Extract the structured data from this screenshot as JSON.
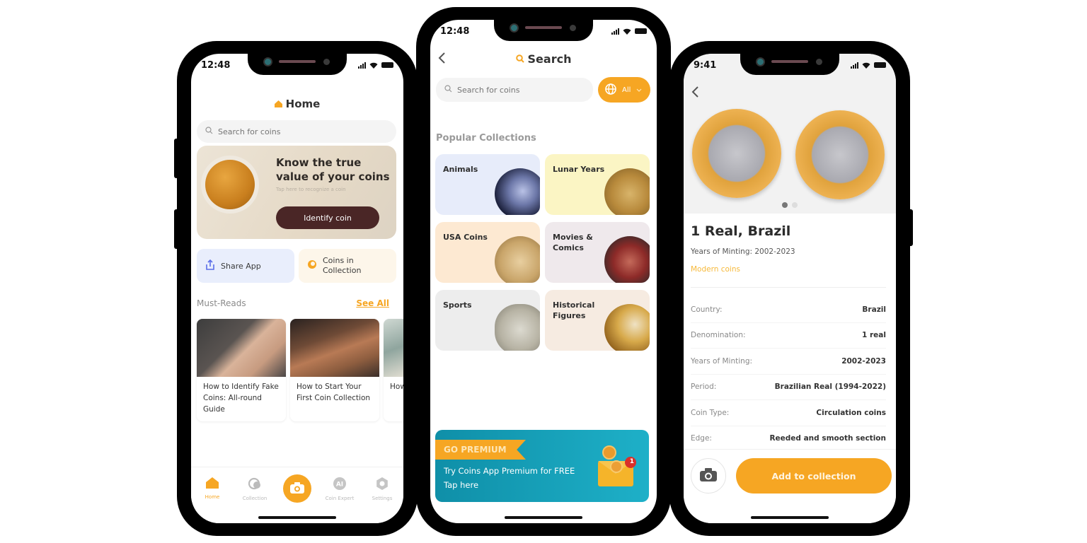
{
  "phones": {
    "home": {
      "status": {
        "time": "12:48"
      },
      "title": "Home",
      "search": {
        "placeholder": "Search for coins"
      },
      "hero": {
        "heading": "Know the true value of your coins",
        "subtitle": "Tap here to recognize a coin",
        "button": "Identify coin"
      },
      "quick_actions": [
        {
          "label": "Share App",
          "icon": "share-icon"
        },
        {
          "label": "Coins in Collection",
          "icon": "coins-icon"
        }
      ],
      "must_reads": {
        "title": "Must-Reads",
        "see_all": "See All",
        "articles": [
          {
            "title": "How to Identify Fake Coins: All-round Guide"
          },
          {
            "title": "How to Start Your First Coin Collection"
          },
          {
            "title": "How to w... a c..."
          }
        ]
      },
      "tabbar": [
        {
          "label": "Home",
          "icon": "home-icon",
          "active": true
        },
        {
          "label": "Collection",
          "icon": "collection-icon",
          "active": false
        },
        {
          "label": "",
          "icon": "camera-icon",
          "active": false
        },
        {
          "label": "Coin Expert",
          "icon": "ai-icon",
          "active": false
        },
        {
          "label": "Settings",
          "icon": "gear-icon",
          "active": false
        }
      ]
    },
    "search": {
      "status": {
        "time": "12:48"
      },
      "title": "Search",
      "search": {
        "placeholder": "Search for coins"
      },
      "filter": {
        "value": "All"
      },
      "popular_title": "Popular Collections",
      "collections": [
        {
          "label": "Animals",
          "bg": "#e7ecfa"
        },
        {
          "label": "Lunar Years",
          "bg": "#fbf5c4"
        },
        {
          "label": "USA Coins",
          "bg": "#fde9d2"
        },
        {
          "label": "Movies & Comics",
          "bg": "#efe9ec"
        },
        {
          "label": "Sports",
          "bg": "#ededed"
        },
        {
          "label": "Historical Figures",
          "bg": "#f6ebe1"
        }
      ],
      "premium": {
        "ribbon": "GO PREMIUM",
        "line1": "Try Coins App Premium for FREE",
        "line2": "Tap here",
        "badge": "1"
      }
    },
    "detail": {
      "status": {
        "time": "9:41"
      },
      "title": "1 Real, Brazil",
      "years_line": "Years of Minting: 2002-2023",
      "tag": "Modern coins",
      "carousel": {
        "current": 1,
        "total": 2
      },
      "properties": [
        {
          "key": "Country:",
          "value": "Brazil"
        },
        {
          "key": "Denomination:",
          "value": "1 real"
        },
        {
          "key": "Years of Minting:",
          "value": "2002-2023"
        },
        {
          "key": "Period:",
          "value": "Brazilian Real (1994-2022)"
        },
        {
          "key": "Coin Type:",
          "value": "Circulation coins"
        },
        {
          "key": "Edge:",
          "value": "Reeded and smooth section"
        }
      ],
      "add_button": "Add to collection"
    }
  },
  "colors": {
    "accent": "#f6a623",
    "identify_button": "#4a2626",
    "premium": "#1aa3bd"
  }
}
